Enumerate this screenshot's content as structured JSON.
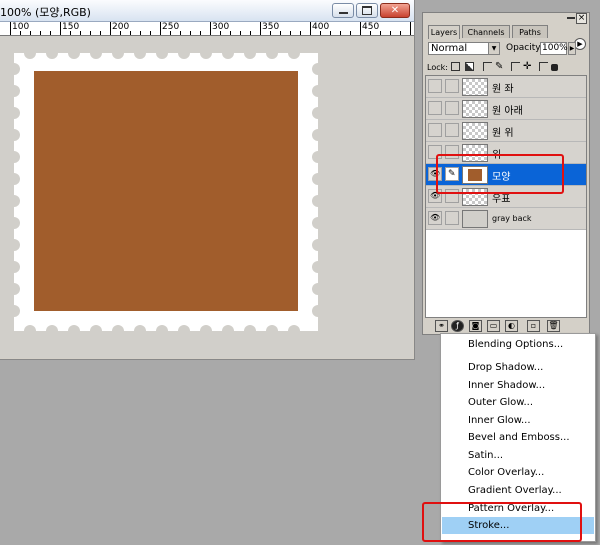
{
  "document": {
    "title": "100% (모양,RGB)",
    "ruler_labels": [
      "100",
      "150",
      "200",
      "250",
      "300",
      "350",
      "400",
      "450"
    ],
    "canvas_color": "#d1cfca",
    "stamp_color": "#a15d2c"
  },
  "window_buttons": {
    "minimize_icon": "minimize-icon",
    "maximize_icon": "maximize-icon",
    "close_icon": "close-icon",
    "close_glyph": "✕"
  },
  "layers_panel": {
    "tabs": [
      {
        "label": "Layers",
        "active": true
      },
      {
        "label": "Channels",
        "active": false
      },
      {
        "label": "Paths",
        "active": false
      }
    ],
    "blend_mode": "Normal",
    "opacity_label": "Opacity:",
    "opacity_value": "100%",
    "lock_label": "Lock:",
    "layers": [
      {
        "name": "원 좌",
        "visible": false,
        "selected": false,
        "thumb": "transparent"
      },
      {
        "name": "원 아래",
        "visible": false,
        "selected": false,
        "thumb": "transparent"
      },
      {
        "name": "원 위",
        "visible": false,
        "selected": false,
        "thumb": "transparent"
      },
      {
        "name": "위",
        "visible": false,
        "selected": false,
        "thumb": "transparent"
      },
      {
        "name": "모양",
        "visible": true,
        "selected": true,
        "thumb": "brown"
      },
      {
        "name": "우표",
        "visible": true,
        "selected": false,
        "thumb": "transparent"
      },
      {
        "name": "gray back",
        "visible": true,
        "selected": false,
        "thumb": "gray"
      }
    ]
  },
  "effects_menu": {
    "items": [
      "Blending Options...",
      "Drop Shadow...",
      "Inner Shadow...",
      "Outer Glow...",
      "Inner Glow...",
      "Bevel and Emboss...",
      "Satin...",
      "Color Overlay...",
      "Gradient Overlay...",
      "Pattern Overlay...",
      "Stroke..."
    ],
    "highlighted": "Stroke..."
  }
}
